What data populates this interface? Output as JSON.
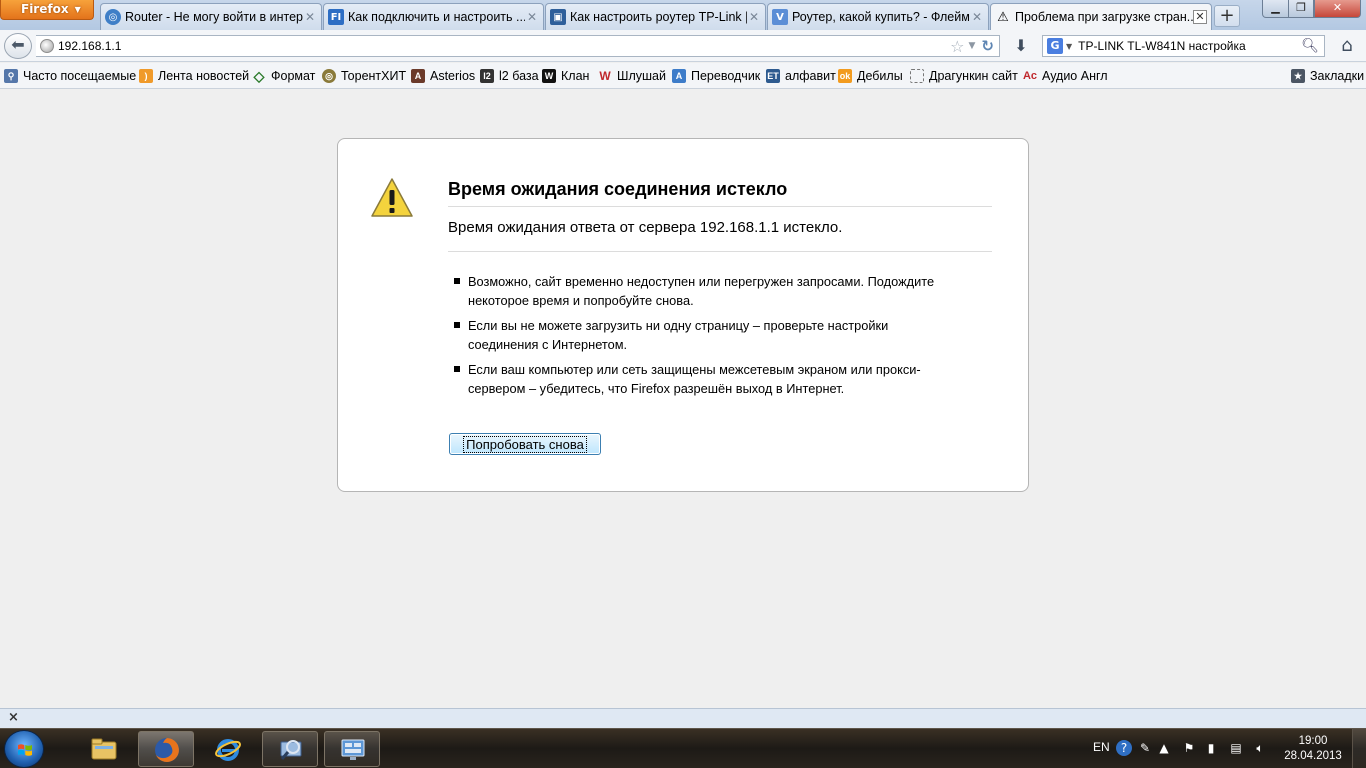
{
  "browser": {
    "menu_button": "Firefox",
    "tabs": [
      {
        "title": "Router - Не могу войти в интер...",
        "favicon": "globe-icon",
        "active": false
      },
      {
        "title": "Как подключить и настроить ...",
        "favicon": "fi-icon",
        "active": false
      },
      {
        "title": "Как настроить роутер TP-Link |...",
        "favicon": "computer-icon",
        "active": false
      },
      {
        "title": "Роутер, какой купить? - Флейм...",
        "favicon": "v-icon",
        "active": false
      },
      {
        "title": "Проблема при загрузке стран...",
        "favicon": "warning-icon",
        "active": true
      }
    ],
    "new_tab": "+",
    "url": "192.168.1.1",
    "search": {
      "engine": "G",
      "query": "TP-LINK TL-W841N настройка"
    }
  },
  "bookmarks": {
    "items": [
      {
        "label": "Часто посещаемые",
        "icon": "smart-folder-icon"
      },
      {
        "label": "Лента новостей",
        "icon": "rss-icon"
      },
      {
        "label": "Формат",
        "icon": "diamond-icon"
      },
      {
        "label": "ТорентХИТ",
        "icon": "globe-icon"
      },
      {
        "label": "Asterios",
        "icon": "asterios-icon"
      },
      {
        "label": "l2 база",
        "icon": "l2-icon"
      },
      {
        "label": "Клан",
        "icon": "clan-icon"
      },
      {
        "label": "Шлушай",
        "icon": "w-icon"
      },
      {
        "label": "Переводчик",
        "icon": "translator-icon"
      },
      {
        "label": "алфавит",
        "icon": "et-icon"
      },
      {
        "label": "Дебилы",
        "icon": "odnoklassniki-icon"
      },
      {
        "label": "Драгункин сайт",
        "icon": "blank-page-icon"
      },
      {
        "label": "Аудио Англ",
        "icon": "ac-icon"
      }
    ],
    "bookmarks_menu": "Закладки"
  },
  "error_page": {
    "title": "Время ожидания соединения истекло",
    "description": "Время ожидания ответа от сервера 192.168.1.1 истекло.",
    "bullets": [
      "Возможно, сайт временно недоступен или перегружен запросами. Подождите некоторое время и попробуйте снова.",
      "Если вы не можете загрузить ни одну страницу – проверьте настройки соединения с Интернетом.",
      "Если ваш компьютер или сеть защищены межсетевым экраном или прокси-сервером – убедитесь, что Firefox разрешён выход в Интернет."
    ],
    "retry_button": "Попробовать снова"
  },
  "addon_bar": {
    "close": "×"
  },
  "taskbar": {
    "apps": [
      "explorer-icon",
      "firefox-icon",
      "ie-icon",
      "magnifier-icon",
      "remote-desktop-icon"
    ],
    "language": "EN",
    "clock_time": "19:00",
    "clock_date": "28.04.2013"
  },
  "colors": {
    "accent_firefox": "#e3731b",
    "content_bg": "#efefef",
    "warning_yellow": "#f5d23a"
  }
}
